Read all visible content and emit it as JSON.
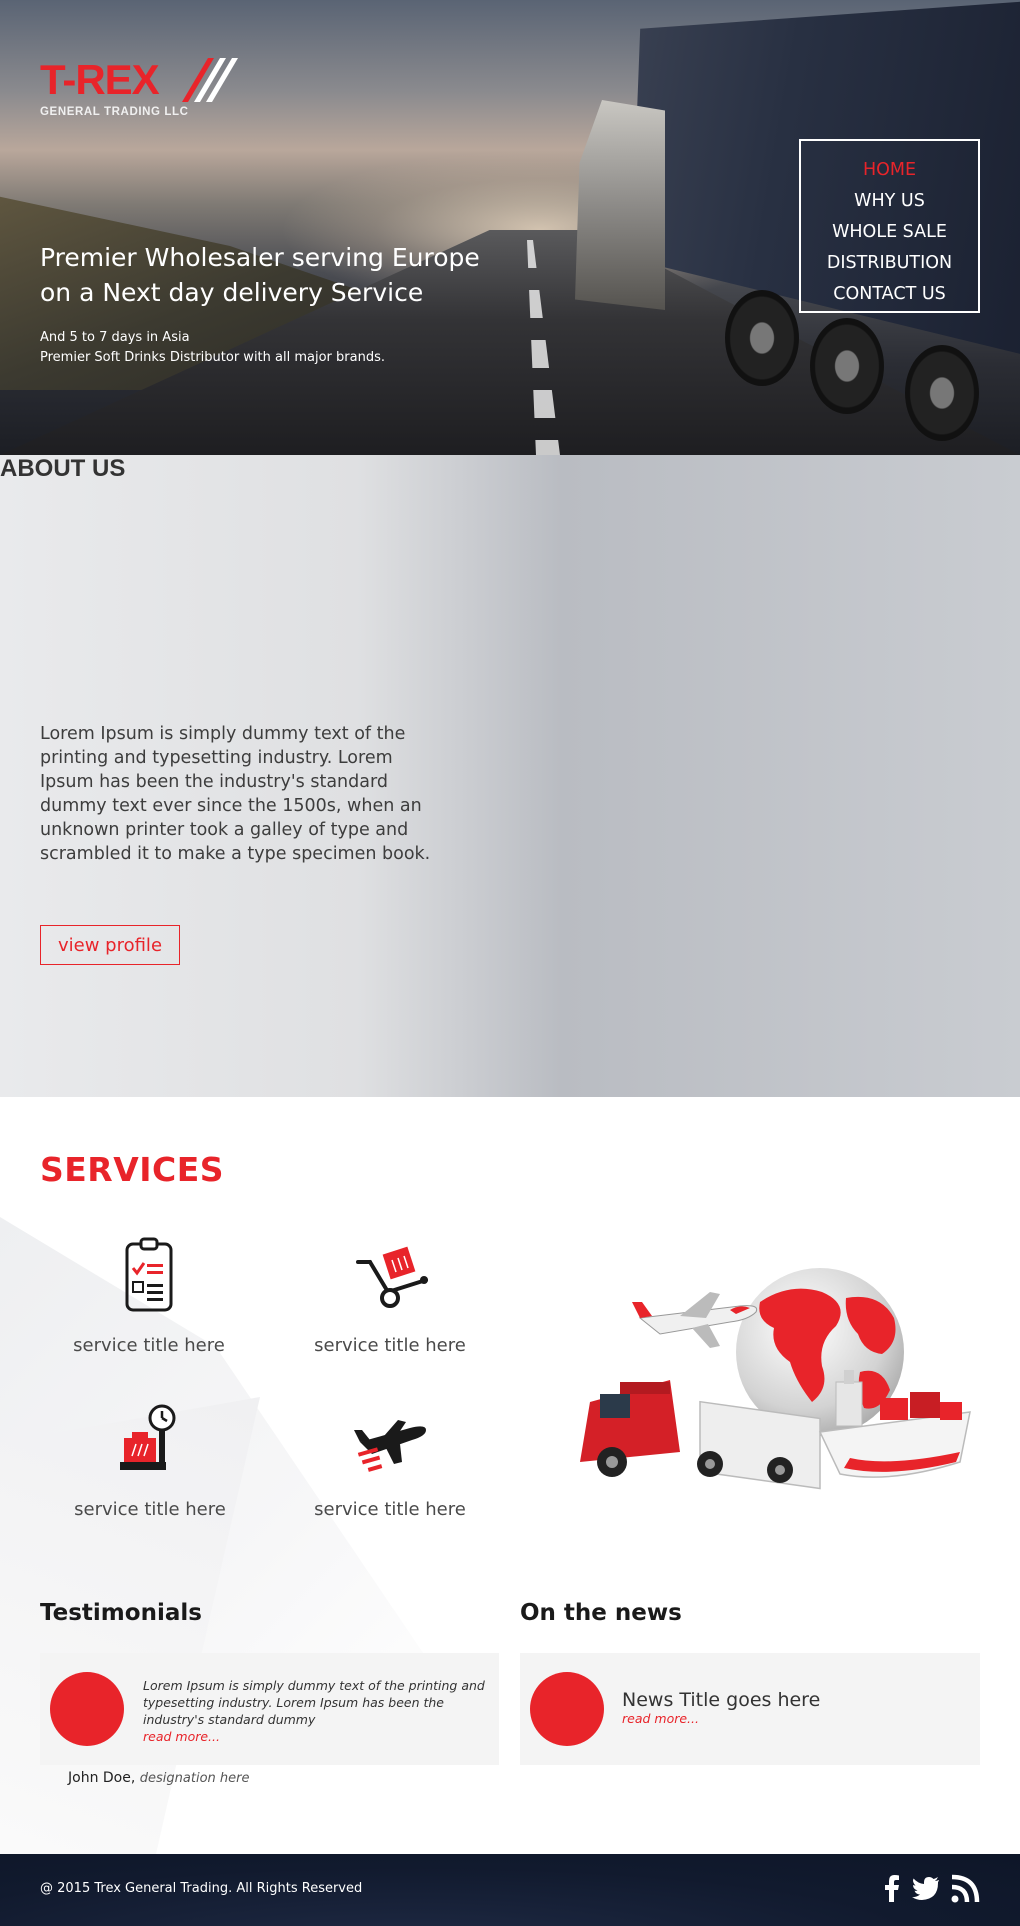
{
  "logo": {
    "brand": "T-REX",
    "subtitle": "GENERAL TRADING LLC"
  },
  "hero": {
    "title_line1": "Premier Wholesaler serving Europe",
    "title_line2": "on a Next day delivery Service",
    "sub_line1": "And 5 to 7 days in Asia",
    "sub_line2": "Premier Soft Drinks Distributor with all major brands."
  },
  "nav": {
    "items": [
      "HOME",
      "WHY US",
      "WHOLE SALE",
      "DISTRIBUTION",
      "CONTACT US"
    ],
    "active_index": 0
  },
  "about": {
    "heading": "ABOUT US",
    "text": "Lorem Ipsum is simply dummy text of the printing and typesetting industry. Lorem Ipsum has been the industry's standard dummy text ever since the 1500s, when an unknown printer took a galley of type and scrambled it to make a type specimen book.",
    "button": "view profile"
  },
  "services": {
    "heading": "SERVICES",
    "items": [
      {
        "label": "service title here",
        "icon": "clipboard-checklist-icon"
      },
      {
        "label": "service title here",
        "icon": "hand-truck-icon"
      },
      {
        "label": "service title here",
        "icon": "weighing-scale-icon"
      },
      {
        "label": "service title here",
        "icon": "airplane-icon"
      }
    ]
  },
  "testimonials": {
    "heading": "Testimonials",
    "quote": "Lorem Ipsum is simply dummy text of the printing and typesetting industry. Lorem Ipsum has been the industry's standard dummy",
    "read_more": "read more...",
    "author": "John Doe,",
    "designation": "designation here"
  },
  "news": {
    "heading": "On the news",
    "title": "News Title goes here",
    "read_more": "read more..."
  },
  "footer": {
    "copyright": "@   2015 Trex General Trading. All Rights Reserved",
    "social": [
      "facebook-icon",
      "twitter-icon",
      "rss-icon"
    ]
  },
  "colors": {
    "accent": "#e8242a",
    "footer_bg": "#111a2e"
  }
}
